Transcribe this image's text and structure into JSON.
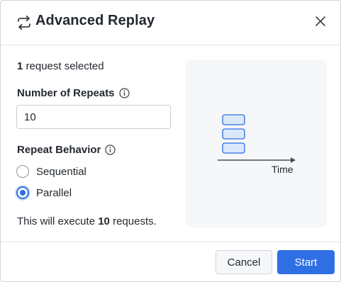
{
  "dialog": {
    "title": "Advanced Replay",
    "title_icon": "replay-arrows-icon",
    "close_icon": "close-icon"
  },
  "selection": {
    "count": "1",
    "suffix": " request selected"
  },
  "repeats": {
    "label": "Number of Repeats",
    "info_icon": "info-icon",
    "value": "10"
  },
  "behavior": {
    "label": "Repeat Behavior",
    "info_icon": "info-icon",
    "options": [
      {
        "label": "Sequential",
        "checked": false
      },
      {
        "label": "Parallel",
        "checked": true
      }
    ]
  },
  "summary": {
    "prefix": "This will execute ",
    "count": "10",
    "suffix": " requests."
  },
  "illustration": {
    "axis_label": "Time"
  },
  "footer": {
    "cancel_label": "Cancel",
    "start_label": "Start"
  },
  "colors": {
    "accent": "#2f6fe4",
    "illustration_bg": "#f6f7f9",
    "block_fill": "#dbe7fb",
    "block_stroke": "#2f6fe4"
  }
}
